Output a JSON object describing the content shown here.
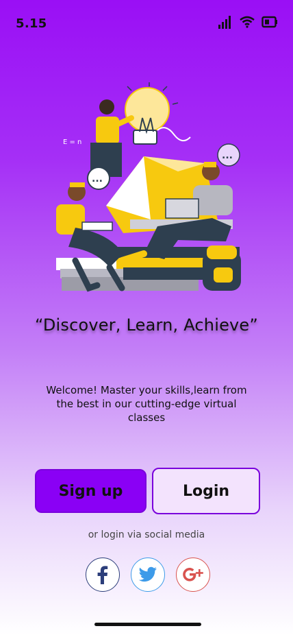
{
  "status_bar": {
    "time": "5.15",
    "icons": [
      "signal-icon",
      "wifi-icon",
      "battery-icon"
    ]
  },
  "hero": {
    "illustration": "students-learning-illustration",
    "bubble_text": "..."
  },
  "tagline": "“Discover, Learn, Achieve”",
  "welcome_text": "Welcome! Master your skills,learn from the best in our cutting-edge virtual classes",
  "buttons": {
    "signup": "Sign up",
    "login": "Login"
  },
  "social": {
    "caption": "or login via social media",
    "providers": [
      {
        "name": "facebook",
        "icon": "facebook-icon",
        "color": "#2c3e7a"
      },
      {
        "name": "twitter",
        "icon": "twitter-icon",
        "color": "#3d9be9"
      },
      {
        "name": "google-plus",
        "icon": "google-plus-icon",
        "color": "#d9534f"
      }
    ]
  },
  "colors": {
    "primary": "#8a00f5",
    "background_top": "#9a0ff5",
    "background_bottom": "#ffffff",
    "accent_yellow": "#f7c90f"
  }
}
